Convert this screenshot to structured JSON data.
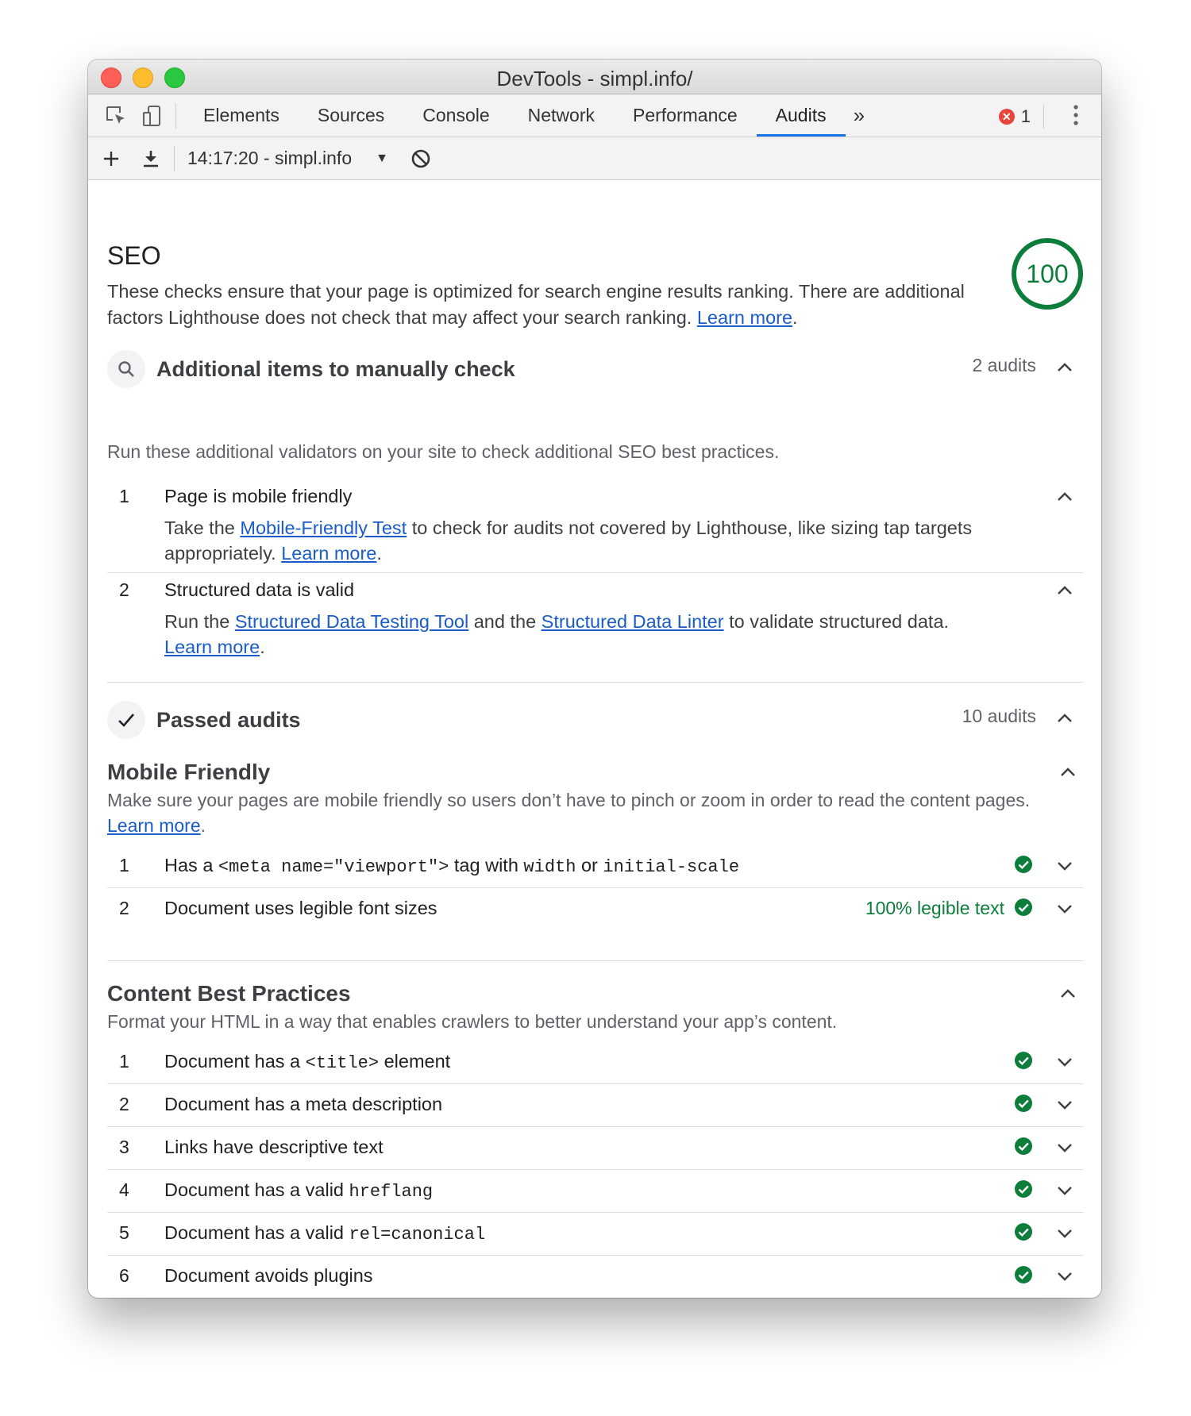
{
  "window": {
    "title": "DevTools - simpl.info/"
  },
  "tabs": [
    "Elements",
    "Sources",
    "Console",
    "Network",
    "Performance",
    "Audits"
  ],
  "active_tab": "Audits",
  "error_count": "1",
  "toolbar": {
    "report": "14:17:20 - simpl.info"
  },
  "seo": {
    "title": "SEO",
    "description": "These checks ensure that your page is optimized for search engine results ranking. There are additional factors Lighthouse does not check that may affect your search ranking.",
    "learn_more": "Learn more",
    "score": "100"
  },
  "manual": {
    "title": "Additional items to manually check",
    "count": "2 audits",
    "description": "Run these additional validators on your site to check additional SEO best practices.",
    "items": [
      {
        "num": "1",
        "title": "Page is mobile friendly",
        "d_pre": "Take the ",
        "d_link": "Mobile-Friendly Test",
        "d_post": " to check for audits not covered by Lighthouse, like sizing tap targets appropriately.",
        "learn_more": "Learn more"
      },
      {
        "num": "2",
        "title": "Structured data is valid",
        "d_pre": "Run the ",
        "d_link1": "Structured Data Testing Tool",
        "d_mid": " and the ",
        "d_link2": "Structured Data Linter",
        "d_post": " to validate structured data.",
        "learn_more": "Learn more"
      }
    ]
  },
  "passed": {
    "title": "Passed audits",
    "count": "10 audits",
    "mobile": {
      "title": "Mobile Friendly",
      "description": "Make sure your pages are mobile friendly so users don’t have to pinch or zoom in order to read the content pages.",
      "learn_more": "Learn more",
      "items": [
        {
          "num": "1",
          "t1": "Has a ",
          "c1": "<meta name=\"viewport\">",
          "t2": " tag with ",
          "c2": "width",
          "t3": " or ",
          "c3": "initial-scale"
        },
        {
          "num": "2",
          "title": "Document uses legible font sizes",
          "value": "100% legible text"
        }
      ]
    },
    "content": {
      "title": "Content Best Practices",
      "description": "Format your HTML in a way that enables crawlers to better understand your app’s content.",
      "items": [
        {
          "num": "1",
          "t1": "Document has a ",
          "c1": "<title>",
          "t2": " element"
        },
        {
          "num": "2",
          "title": "Document has a meta description"
        },
        {
          "num": "3",
          "title": "Links have descriptive text"
        },
        {
          "num": "4",
          "t1": "Document has a valid ",
          "c1": "hreflang"
        },
        {
          "num": "5",
          "t1": "Document has a valid ",
          "c1": "rel=canonical"
        },
        {
          "num": "6",
          "title": "Document avoids plugins"
        }
      ]
    }
  },
  "colors": {
    "pass": "#0c7d3a",
    "accent": "#1a73e8",
    "link": "#1a5cc8",
    "error": "#e8453c"
  },
  "icons": [
    "inspect-icon",
    "device-toolbar-icon",
    "more-tabs-icon",
    "error-icon",
    "kebab-menu-icon",
    "add-icon",
    "download-icon",
    "dropdown-caret-icon",
    "clear-icon",
    "search-icon",
    "check-icon",
    "pass-icon",
    "chevron-up-icon",
    "chevron-down-icon"
  ]
}
